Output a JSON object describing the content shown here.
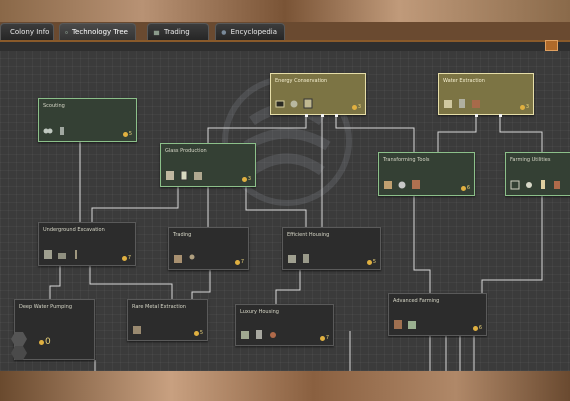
{
  "tabs": [
    {
      "label": "Colony Info",
      "icon": "colony-icon",
      "active": false
    },
    {
      "label": "Technology Tree",
      "icon": "technology-icon",
      "active": true
    },
    {
      "label": "Trading",
      "icon": "trading-icon",
      "active": false
    },
    {
      "label": "Encyclopedia",
      "icon": "encyclopedia-icon",
      "active": false
    }
  ],
  "nodes": {
    "energy_conservation": {
      "title": "Energy Conservation",
      "cost": "3",
      "state": "researched"
    },
    "water_extraction": {
      "title": "Water Extraction",
      "cost": "3",
      "state": "researched"
    },
    "scouting": {
      "title": "Scouting",
      "cost": "5",
      "state": "available"
    },
    "glass_production": {
      "title": "Glass Production",
      "cost": "3",
      "state": "available"
    },
    "transforming_tools": {
      "title": "Transforming Tools",
      "cost": "6",
      "state": "available"
    },
    "farming_utilities": {
      "title": "Farming Utilities",
      "cost": "",
      "state": "available"
    },
    "underground_excavation": {
      "title": "Underground Excavation",
      "cost": "7",
      "state": "locked"
    },
    "trading": {
      "title": "Trading",
      "cost": "7",
      "state": "locked"
    },
    "efficient_housing": {
      "title": "Efficient Housing",
      "cost": "5",
      "state": "locked"
    },
    "deep_water_pumping": {
      "title": "Deep Water Pumping",
      "cost": "0",
      "state": "locked"
    },
    "rare_metal_extraction": {
      "title": "Rare Metal Extraction",
      "cost": "5",
      "state": "locked"
    },
    "luxury_housing": {
      "title": "Luxury Housing",
      "cost": "7",
      "state": "locked"
    },
    "advanced_farming": {
      "title": "Advanced Farming",
      "cost": "6",
      "state": "locked"
    }
  },
  "colors": {
    "researched": "#7c7444",
    "available": "#344034",
    "locked": "#2c2c2c",
    "link": "#d8d8d8",
    "accent": "#b06a2a"
  }
}
